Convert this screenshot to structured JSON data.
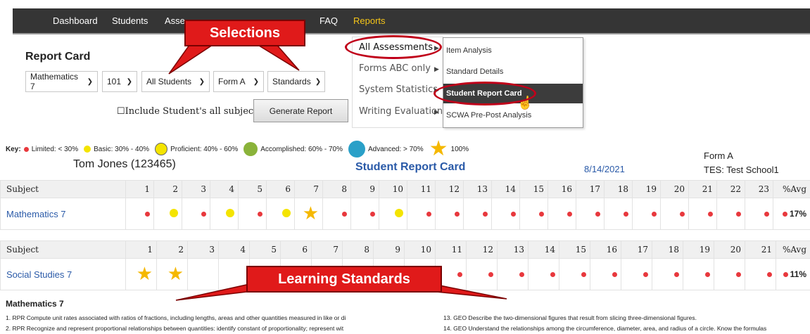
{
  "nav": {
    "items": [
      "Dashboard",
      "Students",
      "Asse",
      "FAQ",
      "Reports"
    ]
  },
  "report": {
    "title": "Report Card",
    "selects": [
      "Mathematics 7",
      "101",
      "All Students",
      "Form A",
      "Standards"
    ],
    "include_label": "Include Student's all subjects",
    "generate_label": "Generate Report"
  },
  "menu1": [
    "All Assessments",
    "Forms ABC only",
    "System Statistics",
    "Writing Evaluation"
  ],
  "menu2": [
    "Item Analysis",
    "Standard Details",
    "Student Report Card",
    "SCWA Pre-Post Analysis"
  ],
  "callouts": {
    "top": "Selections",
    "bottom": "Learning Standards"
  },
  "key": {
    "prefix": "Key:",
    "items": [
      {
        "label": "Limited: < 30%",
        "color": "#e8383d"
      },
      {
        "label": "Basic: 30% - 40%",
        "color": "#f4e400"
      },
      {
        "label": "Proficient: 40% - 60%",
        "color": "#f4e400"
      },
      {
        "label": "Accomplished: 60% - 70%",
        "color": "#8ab33a"
      },
      {
        "label": "Advanced: > 70%",
        "color": "#2aa0c8"
      },
      {
        "label": "100%",
        "color": "#f5b800"
      }
    ]
  },
  "student": {
    "name": "Tom Jones  (123465)",
    "title": "Student Report Card",
    "date": "8/14/2021",
    "form": "Form A",
    "school": "TES: Test School1"
  },
  "math_table": {
    "subject_header": "Subject",
    "avg_header": "%Avg",
    "columns": [
      "1",
      "2",
      "3",
      "4",
      "5",
      "6",
      "7",
      "8",
      "9",
      "10",
      "11",
      "12",
      "13",
      "14",
      "15",
      "16",
      "17",
      "18",
      "19",
      "20",
      "21",
      "22",
      "23"
    ],
    "subject": "Mathematics 7",
    "marks": [
      "r",
      "y",
      "r",
      "y",
      "r",
      "y",
      "s",
      "r",
      "r",
      "y",
      "r",
      "r",
      "r",
      "r",
      "r",
      "r",
      "r",
      "r",
      "r",
      "r",
      "r",
      "r",
      "r"
    ],
    "avg": "17%"
  },
  "ss_table": {
    "subject_header": "Subject",
    "avg_header": "%Avg",
    "columns": [
      "1",
      "2",
      "3",
      "4",
      "5",
      "6",
      "7",
      "8",
      "9",
      "10",
      "11",
      "12",
      "13",
      "14",
      "15",
      "16",
      "17",
      "18",
      "19",
      "20",
      "21"
    ],
    "subject": "Social Studies 7",
    "marks": [
      "s",
      "s",
      "",
      "",
      "",
      "",
      "",
      "",
      "r",
      "r",
      "r",
      "r",
      "r",
      "r",
      "r",
      "r",
      "r",
      "r",
      "r",
      "r",
      "r"
    ],
    "avg": "11%"
  },
  "standards": {
    "title": "Mathematics 7",
    "left": [
      "1. RPR Compute unit rates associated with ratios of fractions, including lengths, areas and other quantities measured in like or di",
      "2. RPR Recognize and represent proportional relationships between quantities: identify constant of proportionality; represent wit"
    ],
    "right": [
      "13. GEO Describe the two-dimensional figures that result from slicing three-dimensional figures.",
      "14. GEO Understand the relationships among the circumference, diameter, area, and radius of a circle. Know the formulas"
    ]
  }
}
